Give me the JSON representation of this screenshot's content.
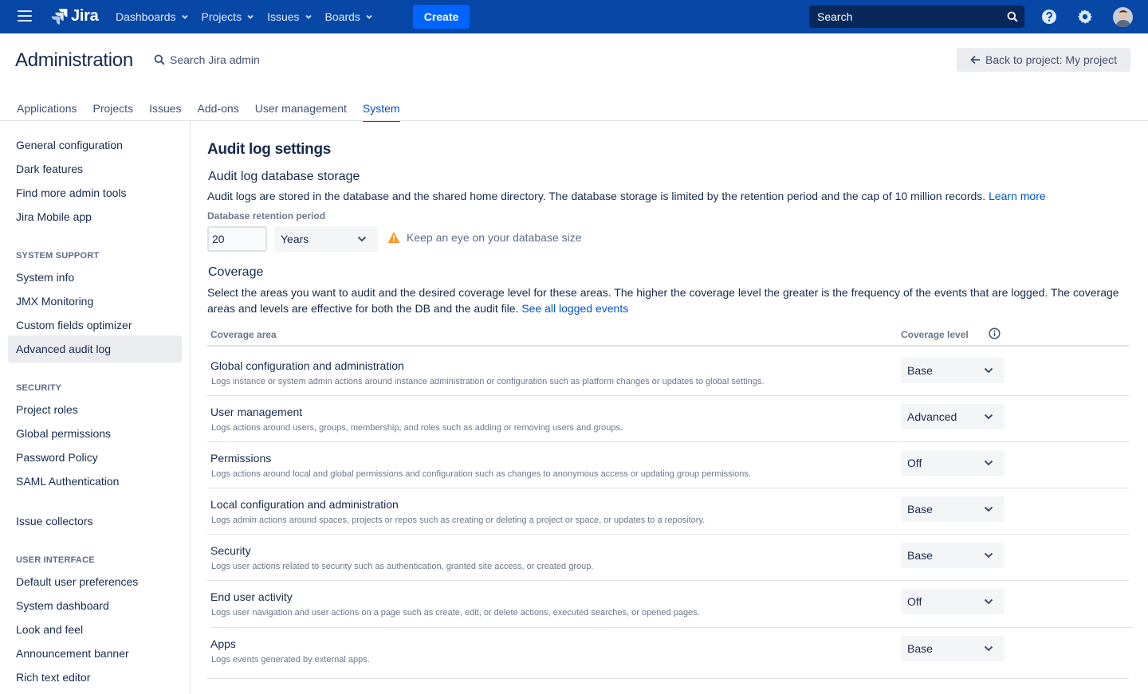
{
  "topnav": {
    "logo": "Jira",
    "items": [
      "Dashboards",
      "Projects",
      "Issues",
      "Boards"
    ],
    "create_label": "Create",
    "search_placeholder": "Search"
  },
  "header": {
    "title": "Administration",
    "admin_search": "Search Jira admin",
    "back_label": "Back to project: My project"
  },
  "tabs": [
    "Applications",
    "Projects",
    "Issues",
    "Add-ons",
    "User management",
    "System"
  ],
  "sidebar": {
    "group0": [
      "General configuration",
      "Dark features",
      "Find more admin tools",
      "Jira Mobile app"
    ],
    "system_support_head": "SYSTEM SUPPORT",
    "system_support": [
      "System info",
      "JMX Monitoring",
      "Custom fields optimizer",
      "Advanced audit log"
    ],
    "security_head": "SECURITY",
    "security": [
      "Project roles",
      "Global permissions",
      "Password Policy",
      "SAML Authentication"
    ],
    "issue_collectors": "Issue collectors",
    "ui_head": "USER INTERFACE",
    "ui": [
      "Default user preferences",
      "System dashboard",
      "Look and feel",
      "Announcement banner",
      "Rich text editor"
    ]
  },
  "main": {
    "title": "Audit log settings",
    "storage": {
      "title": "Audit log database storage",
      "desc": "Audit logs are stored in the database and the shared home directory. The database storage is limited by the retention period and the cap of 10 million records.",
      "learn_more": "Learn more",
      "retention_label": "Database retention period",
      "retention_value": "20",
      "retention_unit": "Years",
      "warning": "Keep an eye on your database size"
    },
    "coverage": {
      "title": "Coverage",
      "desc1": "Select the areas you want to audit and the desired coverage level for these areas. The higher the coverage level the greater is the frequency of the events that are logged. The",
      "desc2": "coverage areas and levels are effective for both the DB and the audit file.",
      "see_all": "See all logged events",
      "col_area": "Coverage area",
      "col_level": "Coverage level",
      "rows": [
        {
          "title": "Global configuration and administration",
          "desc": "Logs instance or system admin actions around instance administration or configuration such as platform changes or updates to global settings.",
          "level": "Base"
        },
        {
          "title": "User management",
          "desc": "Logs actions around users, groups, membership, and roles such as adding or removing users and groups.",
          "level": "Advanced"
        },
        {
          "title": "Permissions",
          "desc": "Logs actions around local and global permissions and configuration such as changes to anonymous access or updating group permissions.",
          "level": "Off"
        },
        {
          "title": "Local configuration and administration",
          "desc": "Logs admin actions around spaces, projects or repos such as creating or deleting a project or space, or updates to a repository.",
          "level": "Base"
        },
        {
          "title": "Security",
          "desc": "Logs user actions related to security such as authentication, granted site access, or created group.",
          "level": "Base"
        },
        {
          "title": "End user activity",
          "desc": "Logs user navigation and user actions on a page such as create, edit, or delete actions, executed searches, or opened pages.",
          "level": "Off"
        },
        {
          "title": "Apps",
          "desc": "Logs events generated by external apps.",
          "level": "Base"
        }
      ]
    }
  }
}
